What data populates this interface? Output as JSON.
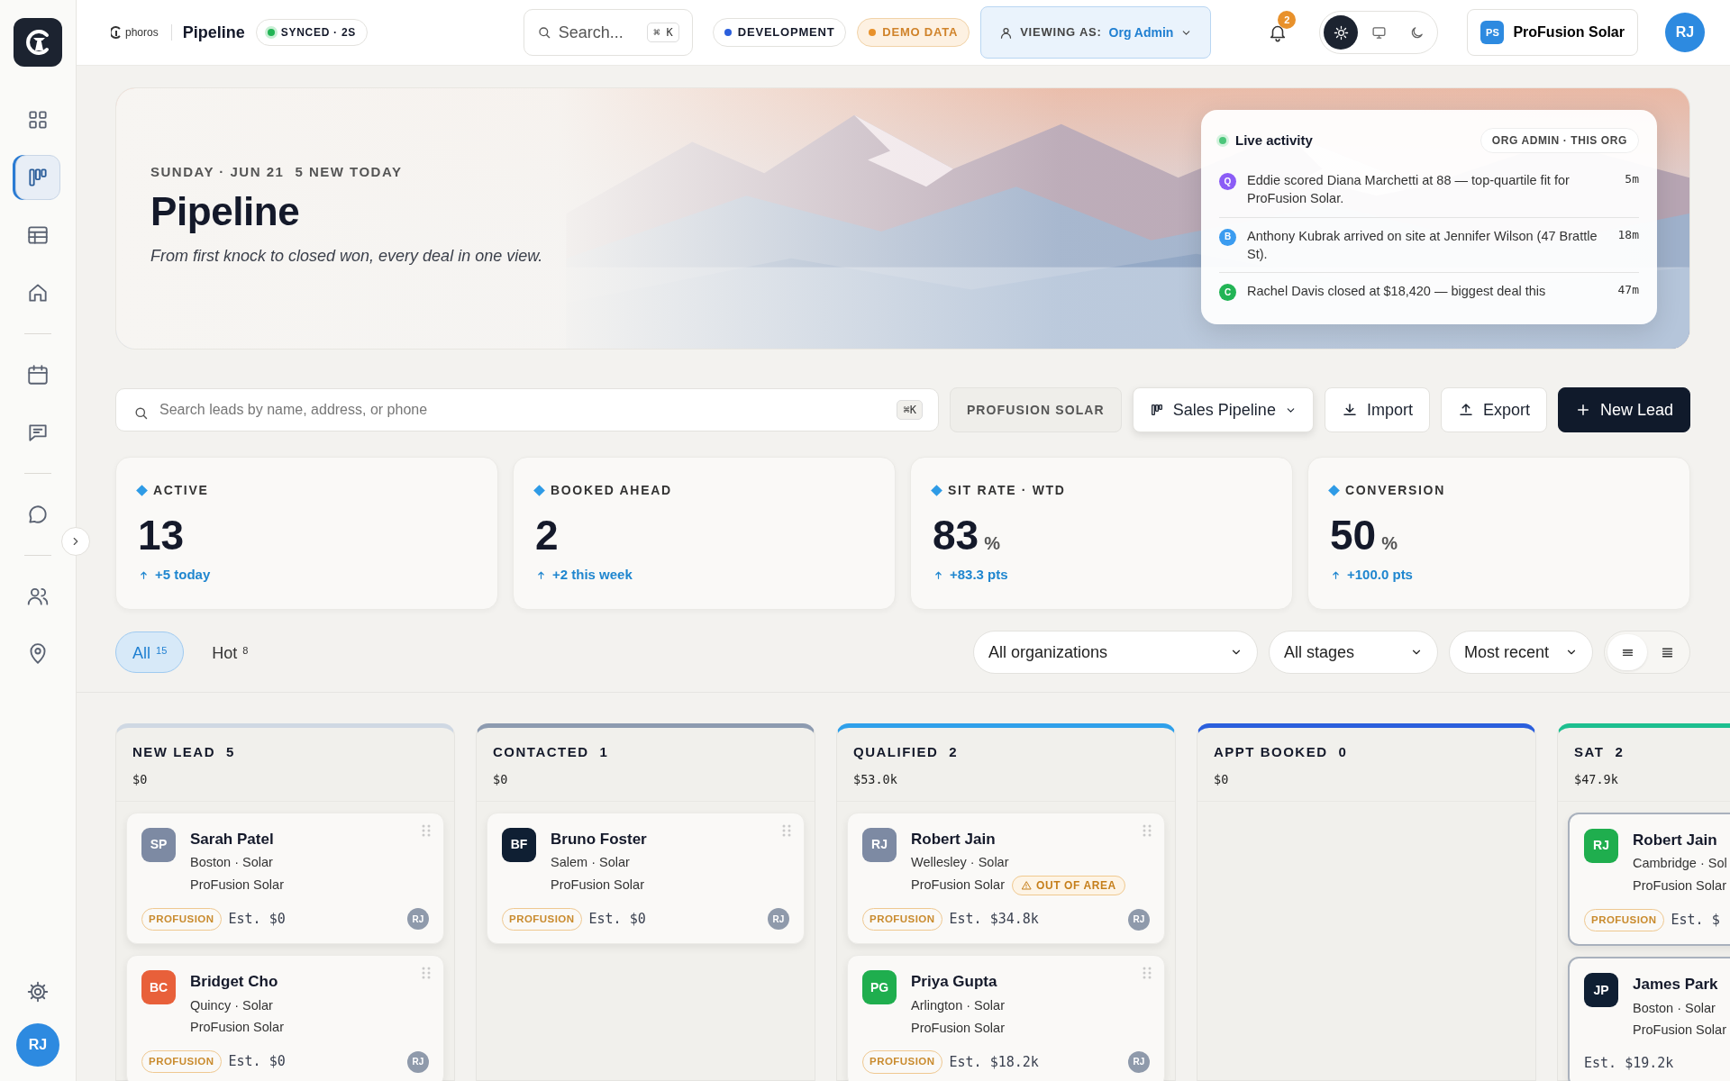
{
  "topbar": {
    "brand": "phoros",
    "page": "Pipeline",
    "sync": "SYNCED · 2S",
    "search": {
      "placeholder": "Search...",
      "shortcut": "⌘ K"
    },
    "env": "DEVELOPMENT",
    "demo": "DEMO DATA",
    "viewing": {
      "label": "VIEWING AS:",
      "role": "Org Admin"
    },
    "notifications": "2",
    "theme": [
      {
        "selected": true
      },
      {
        "selected": false
      },
      {
        "selected": false
      }
    ],
    "org": {
      "initials": "PS",
      "name": "ProFusion Solar"
    },
    "user": "RJ"
  },
  "sidebar": {
    "groups": [
      {
        "items": [
          {
            "selected": false
          },
          {
            "selected": true
          },
          {
            "selected": false
          },
          {
            "selected": false
          }
        ]
      },
      {
        "items": [
          {
            "selected": false
          },
          {
            "selected": false
          }
        ]
      },
      {
        "items": [
          {
            "selected": false
          }
        ]
      },
      {
        "items": [
          {
            "selected": false
          },
          {
            "selected": false
          }
        ]
      }
    ],
    "user": "RJ"
  },
  "hero": {
    "date": "SUNDAY · JUN 21",
    "new_today": "5 NEW TODAY",
    "title": "Pipeline",
    "subtitle": "From first knock to closed won, every deal in one view.",
    "activity": {
      "title": "Live activity",
      "scope": "ORG ADMIN · THIS ORG",
      "items": [
        {
          "initial": "Q",
          "color": "#8b5cf6",
          "text": "Eddie scored Diana Marchetti at 88 — top-quartile fit for ProFusion Solar.",
          "time": "5m"
        },
        {
          "initial": "B",
          "color": "#3b9cf0",
          "text": "Anthony Kubrak arrived on site at Jennifer Wilson (47 Brattle St).",
          "time": "18m"
        },
        {
          "initial": "C",
          "color": "#22b455",
          "text": "Rachel Davis closed at $18,420 — biggest deal this",
          "time": "47m"
        }
      ]
    }
  },
  "toolbar": {
    "search": {
      "placeholder": "Search leads by name, address, or phone",
      "shortcut": "⌘K"
    },
    "org": "PROFUSION SOLAR",
    "pipeline": "Sales Pipeline",
    "buttons": [
      {
        "kind": "import",
        "label": "Import"
      },
      {
        "kind": "export",
        "label": "Export"
      },
      {
        "kind": "new",
        "label": "New Lead"
      }
    ]
  },
  "stats": [
    {
      "label": "ACTIVE",
      "value": "13",
      "delta": "+5 today"
    },
    {
      "label": "BOOKED AHEAD",
      "value": "2",
      "delta": "+2 this week"
    },
    {
      "label": "SIT RATE · WTD",
      "value": "83",
      "unit": "%",
      "delta": "+83.3 pts"
    },
    {
      "label": "CONVERSION",
      "value": "50",
      "unit": "%",
      "delta": "+100.0 pts"
    }
  ],
  "tabs": [
    {
      "label": "All",
      "count": "15",
      "selected": true
    },
    {
      "label": "Hot",
      "count": "8",
      "selected": false
    }
  ],
  "filters": [
    "All organizations",
    "All stages",
    "Most recent"
  ],
  "views": [
    {
      "selected": true
    },
    {
      "selected": false
    }
  ],
  "columns": [
    {
      "title": "NEW LEAD",
      "count": "5",
      "total": "$0",
      "color": "#cfd8e3",
      "cards": [
        {
          "initials": "SP",
          "color": "#7d8aa3",
          "name": "Sarah Patel",
          "location": "Boston · Solar",
          "org": "ProFusion Solar",
          "tag": "PROFUSION",
          "estimate": "Est. $0",
          "owner": "RJ",
          "selected": false
        },
        {
          "initials": "BC",
          "color": "#e8603a",
          "name": "Bridget Cho",
          "location": "Quincy · Solar",
          "org": "ProFusion Solar",
          "tag": "PROFUSION",
          "estimate": "Est. $0",
          "owner": "RJ",
          "selected": false
        }
      ]
    },
    {
      "title": "CONTACTED",
      "count": "1",
      "total": "$0",
      "color": "#8d9bb0",
      "cards": [
        {
          "initials": "BF",
          "color": "#0f1f33",
          "name": "Bruno Foster",
          "location": "Salem · Solar",
          "org": "ProFusion Solar",
          "tag": "PROFUSION",
          "estimate": "Est. $0",
          "owner": "RJ",
          "selected": false
        }
      ]
    },
    {
      "title": "QUALIFIED",
      "count": "2",
      "total": "$53.0k",
      "color": "#2fa0ea",
      "cards": [
        {
          "initials": "RJ",
          "color": "#7d8aa3",
          "name": "Robert Jain",
          "location": "Wellesley · Solar",
          "org": "ProFusion Solar",
          "flag": "OUT OF AREA",
          "tag": "PROFUSION",
          "estimate": "Est. $34.8k",
          "owner": "RJ",
          "selected": false
        },
        {
          "initials": "PG",
          "color": "#1fae4e",
          "name": "Priya Gupta",
          "location": "Arlington · Solar",
          "org": "ProFusion Solar",
          "tag": "PROFUSION",
          "estimate": "Est. $18.2k",
          "owner": "RJ",
          "selected": false
        }
      ]
    },
    {
      "title": "APPT BOOKED",
      "count": "0",
      "total": "$0",
      "color": "#2b5fdc"
    },
    {
      "title": "SAT",
      "count": "2",
      "total": "$47.9k",
      "color": "#1dbf8f",
      "cards": [
        {
          "initials": "RJ",
          "color": "#1fae4e",
          "name": "Robert Jain",
          "location": "Cambridge · Sol",
          "org": "ProFusion Solar",
          "tag": "PROFUSION",
          "estimate": "Est. $",
          "selected": true
        },
        {
          "initials": "JP",
          "color": "#0f1f33",
          "name": "James Park",
          "location": "Boston · Solar",
          "org": "ProFusion Solar",
          "estimate": "Est. $19.2k",
          "selected": true
        }
      ]
    }
  ]
}
